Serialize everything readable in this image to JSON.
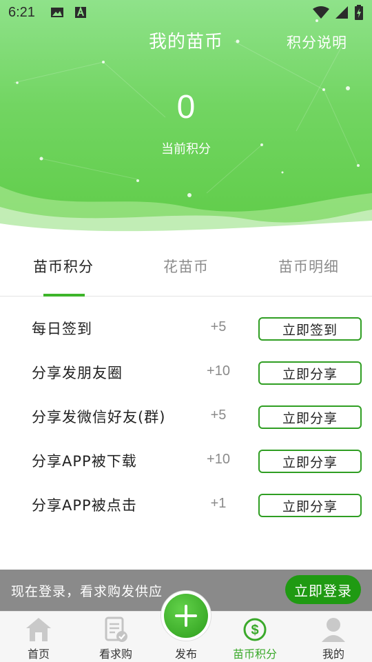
{
  "status_bar": {
    "time": "6:21",
    "icons": [
      "image-icon",
      "text-a-icon",
      "wifi-icon",
      "signal-icon",
      "battery-charging-icon"
    ]
  },
  "header": {
    "title": "我的苗币",
    "rule_link": "积分说明",
    "points_value": "0",
    "points_label": "当前积分",
    "gradient_colors": [
      "#8fe28a",
      "#5fcc48"
    ]
  },
  "tabs": [
    {
      "label": "苗币积分",
      "active": true
    },
    {
      "label": "花苗币",
      "active": false
    },
    {
      "label": "苗币明细",
      "active": false
    }
  ],
  "tasks": [
    {
      "name": "每日签到",
      "points": "+5",
      "action": "立即签到"
    },
    {
      "name": "分享发朋友圈",
      "points": "+10",
      "action": "立即分享"
    },
    {
      "name": "分享发微信好友(群)",
      "points": "+5",
      "action": "立即分享"
    },
    {
      "name": "分享APP被下载",
      "points": "+10",
      "action": "立即分享"
    },
    {
      "name": "分享APP被点击",
      "points": "+1",
      "action": "立即分享"
    }
  ],
  "login_banner": {
    "text": "现在登录，看求购发供应",
    "button": "立即登录"
  },
  "bottom_nav": [
    {
      "label": "首页",
      "icon": "home-icon",
      "active": false
    },
    {
      "label": "看求购",
      "icon": "document-check-icon",
      "active": false
    },
    {
      "label": "发布",
      "icon": "plus-icon",
      "active": false
    },
    {
      "label": "苗币积分",
      "icon": "coin-dollar-icon",
      "active": true
    },
    {
      "label": "我的",
      "icon": "user-icon",
      "active": false
    }
  ],
  "colors": {
    "accent": "#3db52a",
    "button_border": "#2f9e22",
    "login_button": "#1f9a12",
    "banner_bg": "#8a8a8a"
  }
}
